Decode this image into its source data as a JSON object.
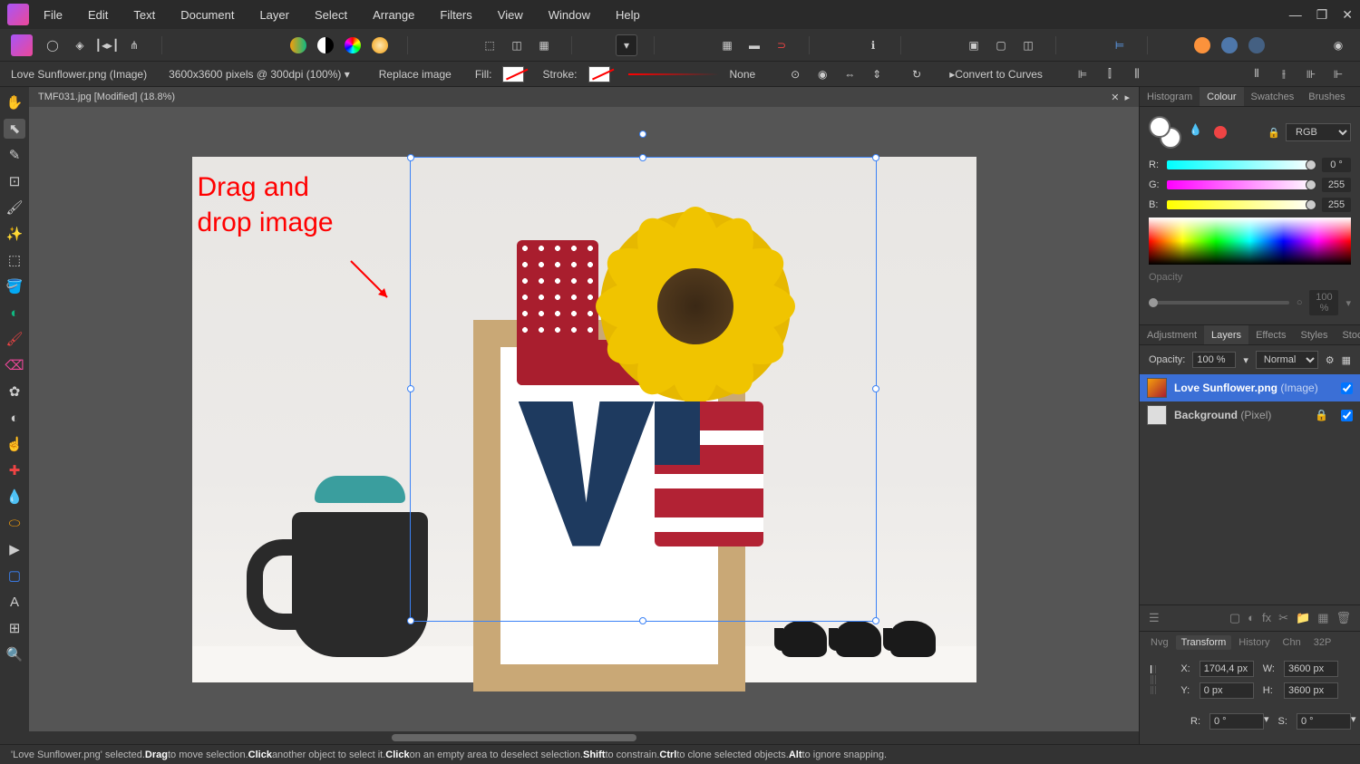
{
  "menu": [
    "File",
    "Edit",
    "Text",
    "Document",
    "Layer",
    "Select",
    "Arrange",
    "Filters",
    "View",
    "Window",
    "Help"
  ],
  "context": {
    "selection_info": "Love Sunflower.png (Image)",
    "dims": "3600x3600 pixels @ 300dpi (100%)",
    "replace": "Replace image",
    "fill": "Fill:",
    "stroke": "Stroke:",
    "strokestyle": "None",
    "curves": "Convert to Curves"
  },
  "doc_tab": "TMF031.jpg [Modified] (18.8%)",
  "annotation": {
    "line1": "Drag and",
    "line2": "drop image"
  },
  "panels": {
    "color_tabs": [
      "Histogram",
      "Colour",
      "Swatches",
      "Brushes"
    ],
    "color_active": "Colour",
    "color_mode": "RGB",
    "r": "0 °",
    "g": "255",
    "b": "255",
    "opacity_label": "Opacity",
    "opacity_val": "100 %",
    "layer_tabs": [
      "Adjustment",
      "Layers",
      "Effects",
      "Styles",
      "Stock"
    ],
    "layer_active": "Layers",
    "opacity_field": "100 %",
    "blend": "Normal",
    "opacity_lbl": "Opacity:",
    "layers": [
      {
        "name": "Love Sunflower.png",
        "type": "(Image)",
        "selected": true
      },
      {
        "name": "Background",
        "type": "(Pixel)",
        "selected": false
      }
    ],
    "transform_tabs": [
      "Nvg",
      "Transform",
      "History",
      "Chn",
      "32P"
    ],
    "transform_active": "Transform",
    "x": "1704,4 px",
    "y": "0 px",
    "w": "3600 px",
    "h": "3600 px",
    "s": "0 °",
    "xlbl": "X:",
    "ylbl": "Y:",
    "wlbl": "W:",
    "hlbl": "H:",
    "rlbl": "R:",
    "slbl": "S:"
  },
  "status": {
    "pre": "'Love Sunflower.png' selected. ",
    "drag": "Drag",
    "drag_t": " to move selection. ",
    "click": "Click",
    "click_t": " another object to select it. ",
    "click2": "Click",
    "click2_t": " on an empty area to deselect selection. ",
    "shift": "Shift",
    "shift_t": " to constrain. ",
    "ctrl": "Ctrl",
    "ctrl_t": " to clone selected objects. ",
    "alt": "Alt",
    "alt_t": " to ignore snapping."
  }
}
